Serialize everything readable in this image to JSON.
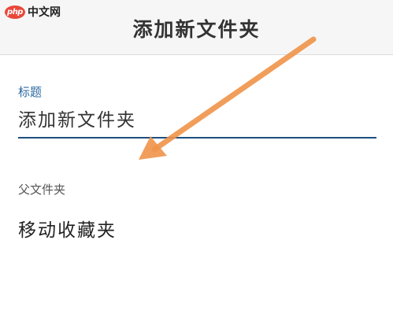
{
  "watermark": {
    "logo_text": "php",
    "site_text": "中文网"
  },
  "header": {
    "title": "添加新文件夹"
  },
  "form": {
    "title_label": "标题",
    "title_value": "添加新文件夹",
    "parent_label": "父文件夹",
    "parent_value": "移动收藏夹"
  },
  "colors": {
    "accent_label": "#2d6aa3",
    "underline": "#1e4f7e",
    "annotation_arrow": "#f0944a"
  }
}
